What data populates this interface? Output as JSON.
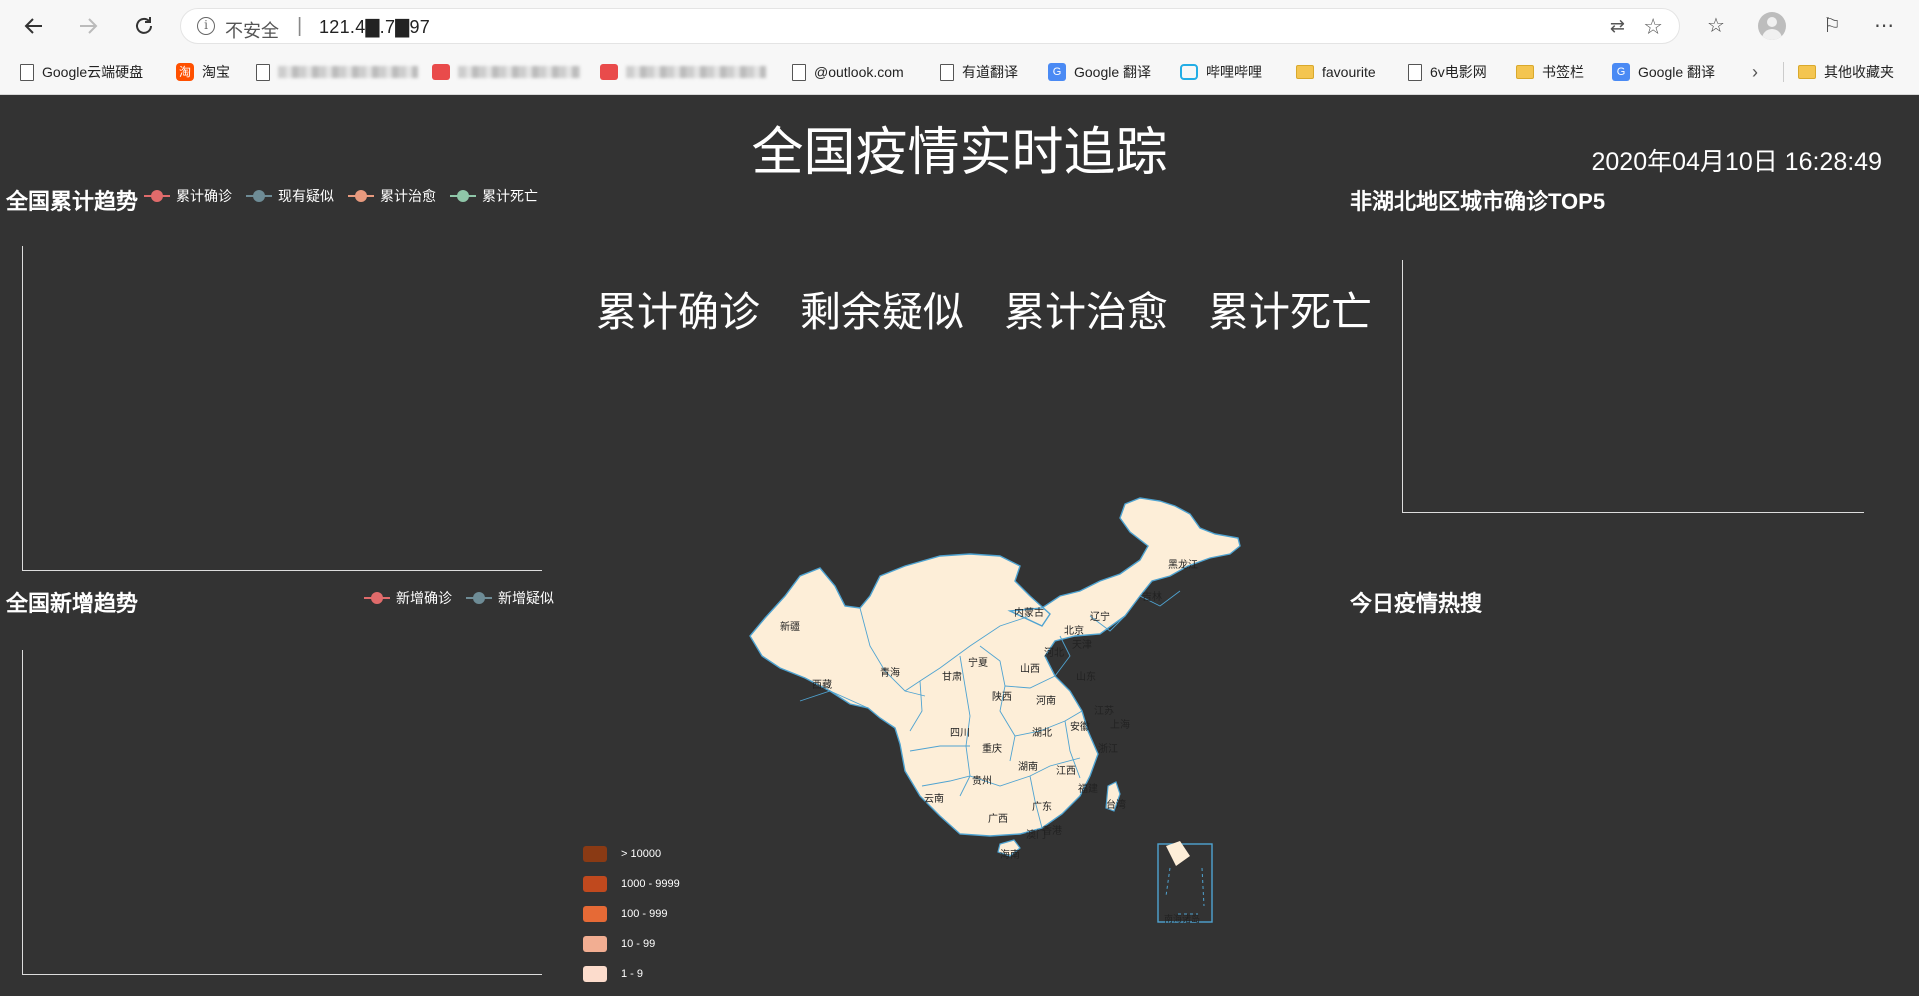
{
  "browser": {
    "back_icon": "arrow-left-icon",
    "forward_icon": "arrow-right-icon",
    "refresh_icon": "refresh-icon",
    "insecure_label": "不安全",
    "separator": "|",
    "url": "121.4▇.7▇97"
  },
  "bookmarks": [
    {
      "label": "Google云端硬盘",
      "icon": "document-icon"
    },
    {
      "label": "淘宝",
      "icon": "taobao-icon"
    },
    {
      "label": "",
      "icon": "document-icon"
    },
    {
      "label": "",
      "icon": "red-icon"
    },
    {
      "label": "",
      "icon": "red-icon"
    },
    {
      "label": "@outlook.com",
      "icon": "document-icon"
    },
    {
      "label": "有道翻译",
      "icon": "document-icon"
    },
    {
      "label": "Google 翻译",
      "icon": "google-translate-icon"
    },
    {
      "label": "哔哩哔哩",
      "icon": "bilibili-icon"
    },
    {
      "label": "favourite",
      "icon": "folder-icon"
    },
    {
      "label": "6v电影网",
      "icon": "document-icon"
    },
    {
      "label": "书签栏",
      "icon": "folder-icon"
    },
    {
      "label": "Google 翻译",
      "icon": "google-translate-icon"
    },
    {
      "label": "其他收藏夹",
      "icon": "folder-icon"
    }
  ],
  "page": {
    "title": "全国疫情实时追踪",
    "datetime": "2020年04月10日 16:28:49",
    "stats": [
      "累计确诊",
      "剩余疑似",
      "累计治愈",
      "累计死亡"
    ]
  },
  "cumulative": {
    "title": "全国累计趋势",
    "legend": [
      {
        "name": "累计确诊",
        "color": "#e06b6b"
      },
      {
        "name": "现有疑似",
        "color": "#6e8c96"
      },
      {
        "name": "累计治愈",
        "color": "#e89a7e"
      },
      {
        "name": "累计死亡",
        "color": "#8fc6a8"
      }
    ]
  },
  "daily": {
    "title": "全国新增趋势",
    "legend": [
      {
        "name": "新增确诊",
        "color": "#e06b6b"
      },
      {
        "name": "新增疑似",
        "color": "#6e8c96"
      }
    ]
  },
  "top5": {
    "title": "非湖北地区城市确诊TOP5"
  },
  "hot": {
    "title": "今日疫情热搜"
  },
  "map": {
    "fill": "#fdeed8",
    "border": "#4fa3d1",
    "provinces": [
      "新疆",
      "西藏",
      "青海",
      "甘肃",
      "内蒙古",
      "黑龙江",
      "吉林",
      "辽宁",
      "北京",
      "天津",
      "河北",
      "山西",
      "宁夏",
      "陕西",
      "河南",
      "山东",
      "江苏",
      "安徽",
      "上海",
      "湖北",
      "四川",
      "重庆",
      "湖南",
      "浙江",
      "江西",
      "贵州",
      "云南",
      "广西",
      "广东",
      "福建",
      "台湾",
      "香港",
      "澳门",
      "海南",
      "南海诸岛"
    ],
    "visual_map": [
      {
        "label": "> 10000",
        "color": "#8a3a14"
      },
      {
        "label": "1000 - 9999",
        "color": "#c0491e"
      },
      {
        "label": "100 - 999",
        "color": "#e66a36"
      },
      {
        "label": "10 - 99",
        "color": "#f2ae92"
      },
      {
        "label": "1 - 9",
        "color": "#fcdccc"
      }
    ]
  }
}
